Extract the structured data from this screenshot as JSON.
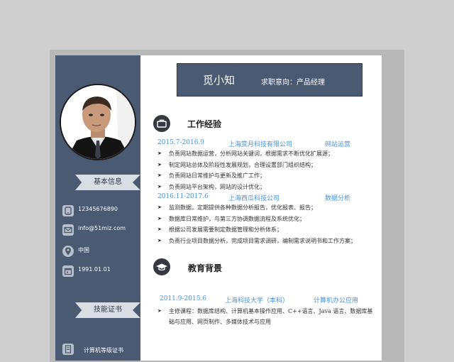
{
  "profile": {
    "name": "觅小知",
    "intent": "求职意向：产品经理"
  },
  "sidebar": {
    "basic_info_label": "基本信息",
    "contacts": [
      {
        "icon": "phone-icon",
        "text": "12345676890"
      },
      {
        "icon": "email-icon",
        "text": "info@51miz.com"
      },
      {
        "icon": "location-icon",
        "text": "中国"
      },
      {
        "icon": "calendar-icon",
        "text": "1991.01.01"
      }
    ],
    "skills_label": "技能证书",
    "skills": [
      {
        "icon": "certificate-icon",
        "text": "计算机等级证书"
      }
    ]
  },
  "work": {
    "title": "工作经验",
    "jobs": [
      {
        "period": "2015.7-2016.9",
        "company": "上海赏月科技有限公司",
        "role": "网站运营",
        "duties": [
          "负责网站数据运营，分析网站关键词，根据需求不断优化扩展源；",
          "制定网站总体及阶段性发展规划，合理设置部门组织结构；",
          "负责网站日常维护与更新及推广工作；",
          "负责网站平台架构，网站的设计优化；"
        ]
      },
      {
        "period": "2016.11-2017.6",
        "company": "上海西瓜科技公司",
        "role": "数据分析",
        "duties": [
          "监测数据，定期提供各种数据分析报告，优化报表、报告；",
          "数据库日常维护，与第三方协调数据流程及系统优化；",
          "根据公司发展需要制定数据管理和分析体系；",
          "负责行业项目数据分析，完成项目需求调研，编制需求说明书和工作方案；"
        ]
      }
    ]
  },
  "education": {
    "title": "教育背景",
    "period": "2011.9-2015.6",
    "school": "上海科技大学（本科）",
    "major": "计算机办公应用",
    "description": "主修课程：数据库结构、计算机基本操作应用、C++语言、Java 语言、数据库基础与应用、网页制作、多媒体技术与应用"
  },
  "colors": {
    "sidebar": "#4a5a72",
    "accent_blue": "#4a90d9",
    "ribbon": "#d9dde4"
  }
}
